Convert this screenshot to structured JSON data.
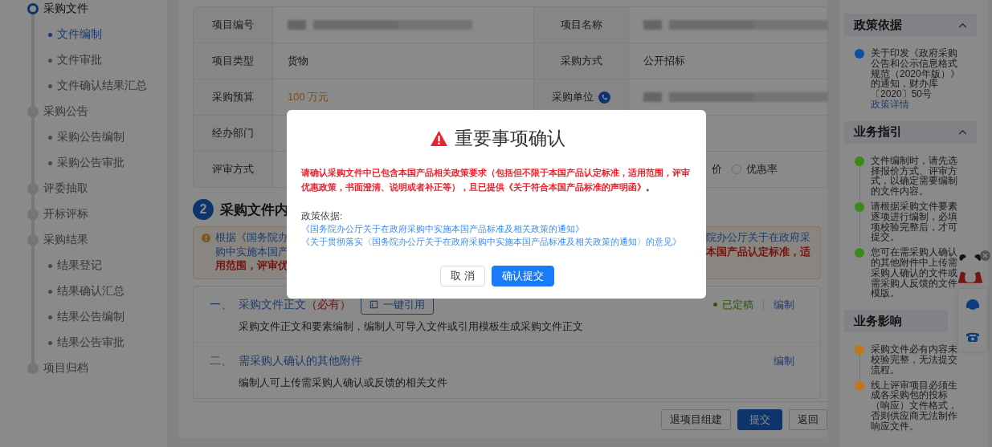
{
  "sidebar": {
    "steps": [
      {
        "label": "采购文件",
        "current": true,
        "children": [
          {
            "label": "文件编制",
            "selected": true
          },
          {
            "label": "文件审批",
            "selected": false
          },
          {
            "label": "文件确认结果汇总",
            "selected": false
          }
        ]
      },
      {
        "label": "采购公告",
        "current": false,
        "children": [
          {
            "label": "采购公告编制",
            "selected": false
          },
          {
            "label": "采购公告审批",
            "selected": false
          }
        ]
      },
      {
        "label": "评委抽取",
        "current": false
      },
      {
        "label": "开标评标",
        "current": false
      },
      {
        "label": "采购结果",
        "current": false,
        "children": [
          {
            "label": "结果登记",
            "selected": false
          },
          {
            "label": "结果确认汇总",
            "selected": false
          },
          {
            "label": "结果公告编制",
            "selected": false
          },
          {
            "label": "结果公告审批",
            "selected": false
          }
        ]
      },
      {
        "label": "项目归档",
        "current": false
      }
    ]
  },
  "project_info": {
    "rows": [
      [
        {
          "label": "项目编号",
          "kind": "blurred"
        },
        {
          "label": "项目名称",
          "kind": "blurred"
        }
      ],
      [
        {
          "label": "项目类型",
          "kind": "text",
          "value": "货物"
        },
        {
          "label": "采购方式",
          "kind": "text",
          "value": "公开招标"
        }
      ],
      [
        {
          "label": "采购预算",
          "kind": "amount",
          "value": "100 万元"
        },
        {
          "label": "采购单位",
          "kind": "blurred",
          "phone_icon": true
        }
      ],
      [
        {
          "label": "经办部门",
          "kind": "covered"
        }
      ],
      [
        {
          "label": "评审方式",
          "kind": "options",
          "cut_text": "价",
          "options": [
            {
              "label": "优惠率",
              "selected": false
            }
          ]
        }
      ]
    ]
  },
  "section": {
    "number": "2",
    "title": "采购文件内"
  },
  "notice": {
    "lines": [
      {
        "left": {
          "text": "根据《国务院办",
          "kind": "link"
        },
        "right": {
          "text": "院办公厅关于在政府采",
          "kind": "link"
        }
      },
      {
        "left": {
          "text": "购中实施本国产",
          "kind": "link"
        },
        "right": {
          "text": "本国产品认定标准，适",
          "kind": "alert"
        }
      },
      {
        "left": {
          "text": "用范围，评审优",
          "kind": "alert"
        }
      }
    ]
  },
  "documents": [
    {
      "number": "一、",
      "title": "采购文件正文",
      "required": "（必有）",
      "action": "一键引用",
      "description": "采购文件正文和要素编制，编制人可导入文件或引用模板生成采购文件正文",
      "status": "已定稿",
      "edit": "编制"
    },
    {
      "number": "二、",
      "title": "需采购人确认的其他附件",
      "description": "编制人可上传需采购人确认或反馈的相关文件",
      "edit": "编制"
    }
  ],
  "footer_buttons": [
    {
      "label": "退项目组建",
      "kind": "default"
    },
    {
      "label": "提交",
      "kind": "primary"
    },
    {
      "label": "返回",
      "kind": "default"
    }
  ],
  "right_panel": {
    "sections": [
      {
        "title": "政策依据",
        "expanded": true,
        "items": [
          {
            "text": "关于印发《政府采购公告和公示信息格式规范（2020年版）》的通知，财办库〔2020〕50号",
            "link": "政策详情",
            "color": "#0d4ea6"
          }
        ]
      },
      {
        "title": "业务指引",
        "expanded": true,
        "items": [
          {
            "text": "文件编制时，请先选择报价方式、评审方式，以确定需要编制的文件内容。",
            "color": "#3a8a1a"
          },
          {
            "text": "请根据采购文件要素逐项进行编制，必填项校验完整后，才可提交。",
            "color": "#3a8a1a"
          },
          {
            "text": "您可在需采购人确认的其他附件中上传需采购人确认的文件或需采购人反馈的文件模版。",
            "color": "#3a8a1a"
          }
        ]
      },
      {
        "title": "业务影响",
        "items": [
          {
            "text": "采购文件必有内容未校验完整，无法提交流程。",
            "color": "#c0761a"
          },
          {
            "text": "线上评审项目必须生成各采购包的投标（响应）文件格式，否则供应商无法制作响应文件。",
            "color": "#c0761a"
          }
        ]
      }
    ]
  },
  "modal": {
    "title": "重要事项确认",
    "warning": "请确认采购文件中已包含本国产品相关政策要求（包括但不限于本国产品认定标准，适用范围，评审优惠政策，书面澄清、说明或者补正等），且已提供《关于符合本国产品标准的声明函》",
    "warning_end": "。",
    "policy_label": "政策依据:",
    "policy_links": [
      "《国务院办公厅关于在政府采购中实施本国产品标准及相关政策的通知》",
      "《关于贯彻落实〈国务院办公厅关于在政府采购中实施本国产品标准及相关政策的通知〉的意见》"
    ],
    "buttons": [
      {
        "label": "取 消",
        "kind": "default"
      },
      {
        "label": "确认提交",
        "kind": "primary"
      }
    ]
  }
}
